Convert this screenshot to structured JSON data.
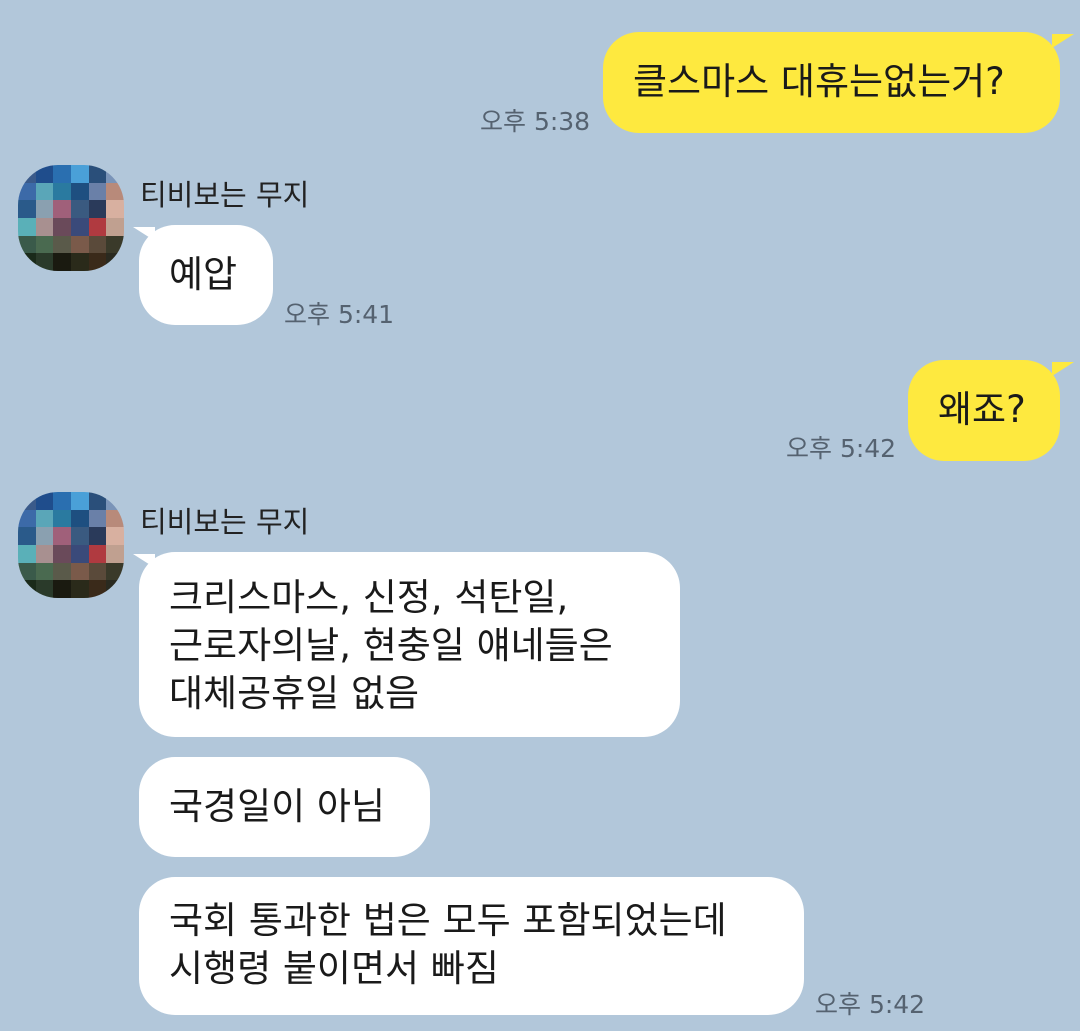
{
  "chat": {
    "messages": [
      {
        "sender": "me",
        "text": "클스마스 대휴는없는거?",
        "time": "오후 5:38"
      },
      {
        "sender": "them",
        "name": "티비보는 무지",
        "text": "예압",
        "time": "오후 5:41"
      },
      {
        "sender": "me",
        "text": "왜죠?",
        "time": "오후 5:42"
      },
      {
        "sender": "them",
        "name": "티비보는 무지",
        "text": "크리스마스, 신정, 석탄일,\n근로자의날, 현충일 얘네들은\n대체공휴일 없음"
      },
      {
        "sender": "them",
        "text": "국경일이 아님"
      },
      {
        "sender": "them",
        "text": "국회 통과한 법은 모두 포함되었는데\n시행령 붙이면서 빠짐",
        "time": "오후 5:42"
      }
    ]
  },
  "colors": {
    "background": "#b2c7da",
    "my_bubble": "#fee93f",
    "their_bubble": "#ffffff",
    "time_text": "#556270"
  },
  "avatar_icon": "pixelated-profile-image"
}
